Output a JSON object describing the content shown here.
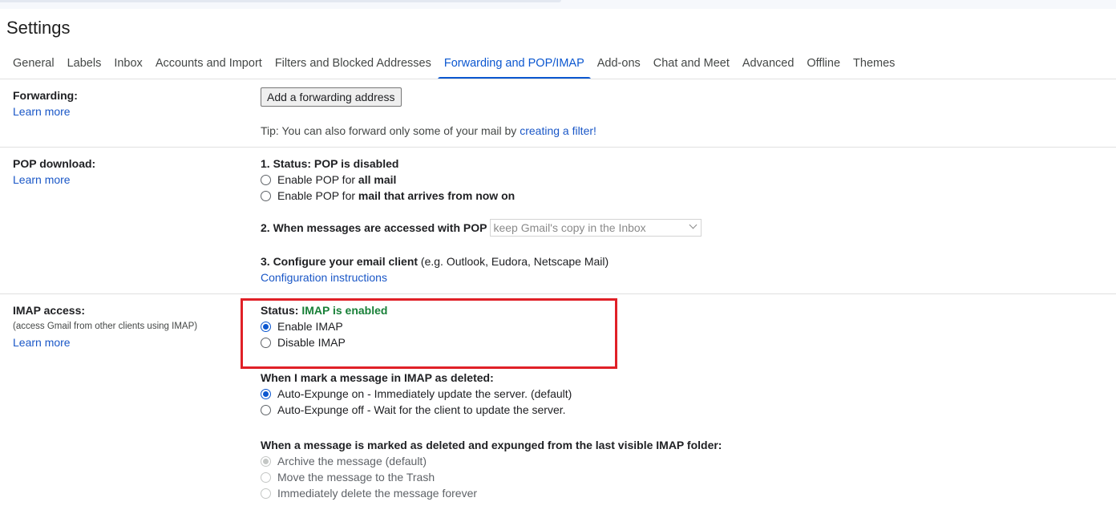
{
  "page_title": "Settings",
  "tabs": [
    {
      "label": "General"
    },
    {
      "label": "Labels"
    },
    {
      "label": "Inbox"
    },
    {
      "label": "Accounts and Import"
    },
    {
      "label": "Filters and Blocked Addresses"
    },
    {
      "label": "Forwarding and POP/IMAP"
    },
    {
      "label": "Add-ons"
    },
    {
      "label": "Chat and Meet"
    },
    {
      "label": "Advanced"
    },
    {
      "label": "Offline"
    },
    {
      "label": "Themes"
    }
  ],
  "active_tab": "Forwarding and POP/IMAP",
  "forwarding": {
    "title": "Forwarding:",
    "learn_more": "Learn more",
    "add_button": "Add a forwarding address",
    "tip_prefix": "Tip: You can also forward only some of your mail by ",
    "tip_link": "creating a filter!"
  },
  "pop": {
    "title": "POP download:",
    "learn_more": "Learn more",
    "status_label": "1. Status: POP is disabled",
    "option_all_prefix": "Enable POP for ",
    "option_all_bold": "all mail",
    "option_now_prefix": "Enable POP for ",
    "option_now_bold": "mail that arrives from now on",
    "accessed_label": "2. When messages are accessed with POP",
    "accessed_select_value": "keep Gmail's copy in the Inbox",
    "configure_label": "3. Configure your email client",
    "configure_note": " (e.g. Outlook, Eudora, Netscape Mail)",
    "config_link": "Configuration instructions"
  },
  "imap": {
    "title": "IMAP access:",
    "subtitle": "(access Gmail from other clients using IMAP)",
    "learn_more": "Learn more",
    "status_label": "Status: ",
    "status_value": "IMAP is enabled",
    "enable_label": "Enable IMAP",
    "disable_label": "Disable IMAP",
    "deleted_heading": "When I mark a message in IMAP as deleted:",
    "expunge_on": "Auto-Expunge on - Immediately update the server. (default)",
    "expunge_off": "Auto-Expunge off - Wait for the client to update the server.",
    "expunged_heading": "When a message is marked as deleted and expunged from the last visible IMAP folder:",
    "archive": "Archive the message (default)",
    "trash": "Move the message to the Trash",
    "delete_forever": "Immediately delete the message forever"
  },
  "colors": {
    "accent": "#0b57d0",
    "link": "#1a57c7",
    "status_green": "#188038",
    "highlight_box": "#e02027"
  }
}
